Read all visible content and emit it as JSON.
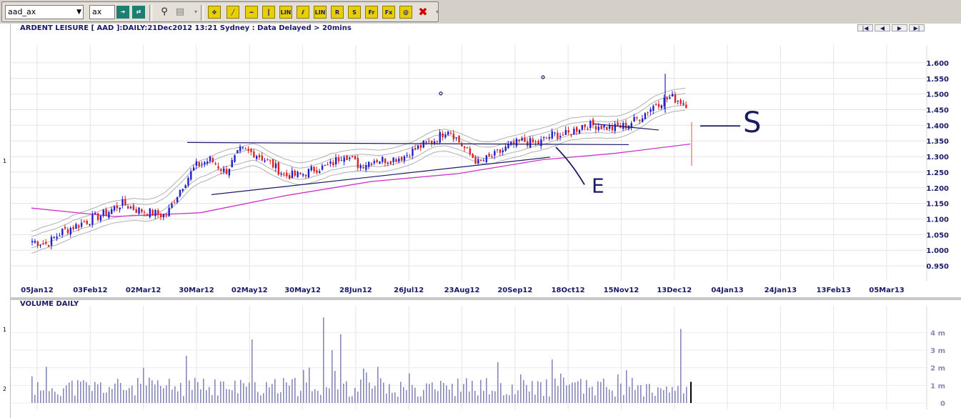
{
  "toolbar": {
    "symbol": "aad_ax",
    "exchange": "ax",
    "buttons": [
      "LIN",
      "LIN",
      "R",
      "S",
      "Fr",
      "Fx"
    ]
  },
  "chart": {
    "title": "ARDENT LEISURE [ AAD ]:DAILY:21Dec2012 13:21 Sydney : Data Delayed > 20mins",
    "volume_title": "VOLUME DAILY",
    "left_labels": [
      "1",
      "1",
      "2"
    ],
    "annotations": [
      "E",
      "S"
    ],
    "colors": {
      "up": "#2020cc",
      "down": "#dd2222",
      "ma": "#cc33cc",
      "band": "#b0b0b0",
      "trend": "#1a1a66",
      "volume": "#8888bb"
    }
  },
  "chart_data": [
    {
      "type": "candlestick",
      "title": "ARDENT LEISURE [ AAD ]:DAILY:21Dec2012 13:21 Sydney : Data Delayed > 20mins",
      "x_ticks": [
        "05Jan12",
        "03Feb12",
        "02Mar12",
        "30Mar12",
        "02May12",
        "30May12",
        "28Jun12",
        "26Jul12",
        "23Aug12",
        "20Sep12",
        "18Oct12",
        "15Nov12",
        "13Dec12",
        "04Jan13",
        "24Jan13",
        "13Feb13",
        "05Mar13"
      ],
      "y_ticks": [
        "1.600",
        "1.550",
        "1.500",
        "1.450",
        "1.400",
        "1.350",
        "1.300",
        "1.250",
        "1.200",
        "1.150",
        "1.100",
        "1.050",
        "1.000",
        "0.950"
      ],
      "ylim": [
        0.925,
        1.625
      ],
      "close_approx": [
        1.03,
        1.02,
        1.06,
        1.08,
        1.1,
        1.12,
        1.15,
        1.13,
        1.12,
        1.11,
        1.2,
        1.27,
        1.29,
        1.25,
        1.32,
        1.31,
        1.28,
        1.24,
        1.24,
        1.26,
        1.27,
        1.31,
        1.27,
        1.29,
        1.29,
        1.3,
        1.33,
        1.35,
        1.39,
        1.33,
        1.28,
        1.3,
        1.33,
        1.35,
        1.34,
        1.37,
        1.37,
        1.4,
        1.4,
        1.39,
        1.4,
        1.43,
        1.47,
        1.49,
        1.47
      ]
    },
    {
      "type": "bar",
      "title": "VOLUME DAILY",
      "y_ticks": [
        "4 m",
        "3 m",
        "2 m",
        "1 m",
        "0"
      ],
      "ylim": [
        0,
        4.5
      ]
    }
  ]
}
